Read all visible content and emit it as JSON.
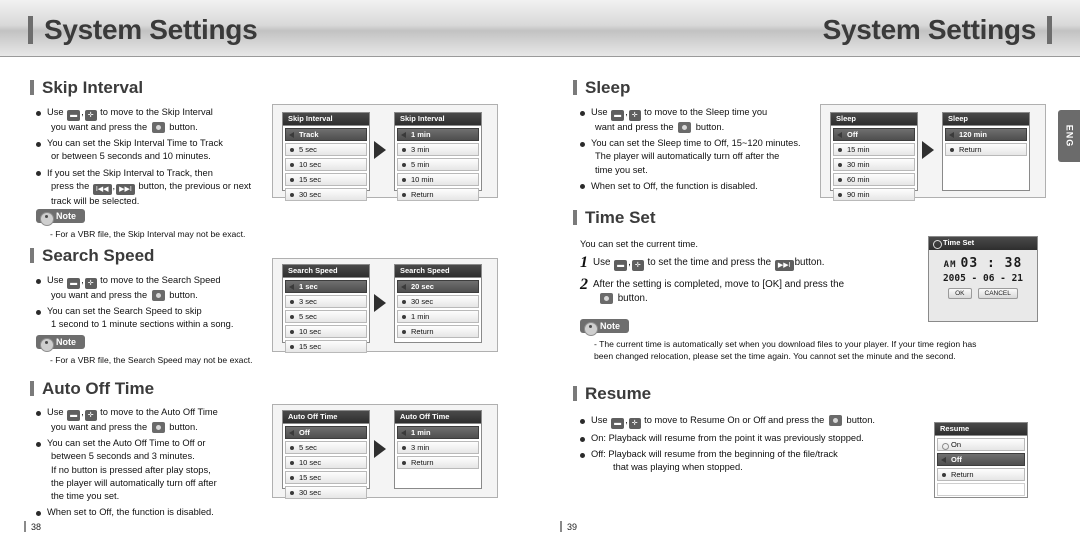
{
  "header": {
    "title_left": "System Settings",
    "title_right": "System Settings",
    "side_tab": "ENG"
  },
  "footer": {
    "left_page": "38",
    "right_page": "39"
  },
  "left": {
    "skip": {
      "heading": "Skip Interval",
      "bullets": [
        "Use  ,  to move to the Skip Interval you want and press the   button.",
        "You can set the Skip Interval Time to Track or between 5 seconds and 10 minutes.",
        "If you set the Skip Interval to Track, then press the   ,   button, the previous or next track will be selected."
      ],
      "note_label": "Note",
      "note_text": "- For a VBR file, the Skip Interval may not be exact.",
      "screen1": {
        "title": "Skip Interval",
        "items": [
          "Track",
          "5 sec",
          "10 sec",
          "15 sec",
          "30 sec"
        ],
        "selected": 0
      },
      "screen2": {
        "title": "Skip Interval",
        "items": [
          "1 min",
          "3 min",
          "5 min",
          "10 min",
          "Return"
        ],
        "selected": 0
      }
    },
    "search": {
      "heading": "Search Speed",
      "bullets": [
        "Use  ,  to move to the Search Speed you want and press the   button.",
        "You can set the Search Speed to skip 1 second to 1 minute sections within a song."
      ],
      "note_label": "Note",
      "note_text": "- For a VBR file, the Search Speed may not be exact.",
      "screen1": {
        "title": "Search Speed",
        "items": [
          "1 sec",
          "3 sec",
          "5 sec",
          "10 sec",
          "15 sec"
        ],
        "selected": 0
      },
      "screen2": {
        "title": "Search Speed",
        "items": [
          "20 sec",
          "30 sec",
          "1 min",
          "Return"
        ],
        "selected": 0
      }
    },
    "autooff": {
      "heading": "Auto Off Time",
      "bullets": [
        "Use  ,  to move to the Auto Off Time you want and press the   button.",
        "You can set the Auto Off Time to Off or between 5 seconds and 3 minutes. If no button is pressed after play stops, the player will automatically turn off after the time you set.",
        "When set to Off, the function is disabled."
      ],
      "screen1": {
        "title": "Auto Off Time",
        "items": [
          "Off",
          "5 sec",
          "10 sec",
          "15 sec",
          "30 sec"
        ],
        "selected": 0
      },
      "screen2": {
        "title": "Auto Off Time",
        "items": [
          "1 min",
          "3 min",
          "Return"
        ],
        "selected": 0
      }
    }
  },
  "right": {
    "sleep": {
      "heading": "Sleep",
      "bullets": [
        "Use  ,  to move to the Sleep time you want and press the   button.",
        "You can set the Sleep time to Off, 15~120 minutes. The player will automatically turn off after the time you set.",
        "When set to Off, the function is disabled."
      ],
      "screen1": {
        "title": "Sleep",
        "items": [
          "Off",
          "15 min",
          "30 min",
          "60 min",
          "90 min"
        ],
        "selected": 0
      },
      "screen2": {
        "title": "Sleep",
        "items": [
          "120 min",
          "Return"
        ],
        "selected": 0
      }
    },
    "timeset": {
      "heading": "Time Set",
      "intro": "You can set the current time.",
      "steps": [
        {
          "n": "1",
          "text": "Use  ,  to set the time and press the   button."
        },
        {
          "n": "2",
          "text": "After the setting is completed, move to [OK] and press the   button."
        }
      ],
      "note_label": "Note",
      "note_text": "- The current time is automatically set when you download files to your player. If your time region has been changed relocation, please set the time again. You cannot set the minute and the second.",
      "screen": {
        "title": "Time Set",
        "ampm": "AM",
        "time": "03 : 38",
        "date": "2005 - 06 - 21",
        "ok": "OK",
        "cancel": "CANCEL"
      }
    },
    "resume": {
      "heading": "Resume",
      "bullets": [
        "Use  ,  to move to Resume On or Off and press the   button.",
        "On: Playback will resume from the point it was previously stopped.",
        "Off: Playback will resume from the beginning of the file/track that was playing when stopped."
      ],
      "screen": {
        "title": "Resume",
        "items": [
          "On",
          "Off",
          "Return"
        ],
        "selected": 1
      }
    }
  }
}
